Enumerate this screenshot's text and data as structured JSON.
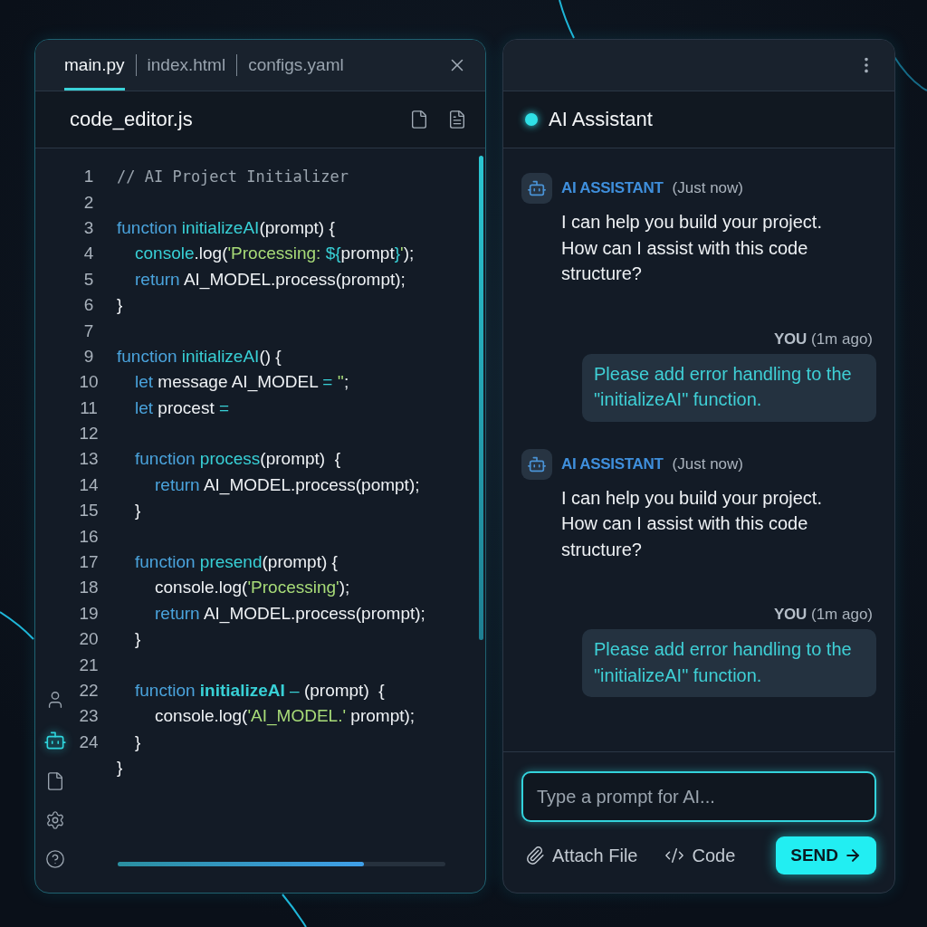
{
  "editor": {
    "tabs": [
      {
        "label": "main.py",
        "selected": true
      },
      {
        "label": "index.html",
        "selected": false
      },
      {
        "label": "configs.yaml",
        "selected": false
      }
    ],
    "file_title": "code_editor.js",
    "lines": [
      {
        "number": "1",
        "kind": "indent0",
        "tokens": [
          {
            "kind": "comment",
            "text": "// AI Project Initializer"
          }
        ]
      },
      {
        "number": "2"
      },
      {
        "number": "3",
        "kind": "indent0",
        "tokens": [
          {
            "kind": "keyword",
            "text": "function "
          },
          {
            "kind": "name",
            "text": "initializeAI"
          },
          {
            "kind": "plain",
            "text": "(prompt) {"
          }
        ]
      },
      {
        "number": "4",
        "kind": "indent1",
        "tokens": [
          {
            "kind": "name",
            "text": "console"
          },
          {
            "kind": "plain",
            "text": ".log("
          },
          {
            "kind": "string",
            "text": "'Processing: "
          },
          {
            "kind": "name",
            "text": "${"
          },
          {
            "kind": "plain",
            "text": "prompt"
          },
          {
            "kind": "name",
            "text": "}"
          },
          {
            "kind": "string",
            "text": "'"
          },
          {
            "kind": "plain",
            "text": ");"
          }
        ]
      },
      {
        "number": "5",
        "kind": "indent1",
        "tokens": [
          {
            "kind": "keyword",
            "text": "return "
          },
          {
            "kind": "plain",
            "text": "AI_MODEL.process(prompt);"
          }
        ]
      },
      {
        "number": "6",
        "kind": "indent0",
        "tokens": [
          {
            "kind": "plain",
            "text": "}"
          }
        ]
      },
      {
        "number": "7"
      },
      {
        "number": "9",
        "kind": "indent0",
        "tokens": [
          {
            "kind": "keyword",
            "text": "function "
          },
          {
            "kind": "name",
            "text": "initializeAI"
          },
          {
            "kind": "plain",
            "text": "() {"
          }
        ]
      },
      {
        "number": "10",
        "kind": "indent1",
        "tokens": [
          {
            "kind": "keyword",
            "text": "let "
          },
          {
            "kind": "plain",
            "text": "message AI_MODEL "
          },
          {
            "kind": "name",
            "text": "= "
          },
          {
            "kind": "string",
            "text": "''"
          },
          {
            "kind": "plain",
            "text": ";"
          }
        ]
      },
      {
        "number": "11",
        "kind": "indent1",
        "tokens": [
          {
            "kind": "keyword",
            "text": "let "
          },
          {
            "kind": "plain",
            "text": "procest "
          },
          {
            "kind": "name",
            "text": "="
          }
        ]
      },
      {
        "number": "12"
      },
      {
        "number": "13",
        "kind": "indent1",
        "tokens": [
          {
            "kind": "keyword",
            "text": "function "
          },
          {
            "kind": "name",
            "text": "process"
          },
          {
            "kind": "plain",
            "text": "(prompt)  {"
          }
        ]
      },
      {
        "number": "14",
        "kind": "indent2",
        "tokens": [
          {
            "kind": "keyword",
            "text": "return "
          },
          {
            "kind": "plain",
            "text": "AI_MODEL.process(pompt);"
          }
        ]
      },
      {
        "number": "15",
        "kind": "indent1",
        "tokens": [
          {
            "kind": "plain",
            "text": "}"
          }
        ]
      },
      {
        "number": "16"
      },
      {
        "number": "17",
        "kind": "indent1",
        "tokens": [
          {
            "kind": "keyword",
            "text": "function "
          },
          {
            "kind": "name",
            "text": "presend"
          },
          {
            "kind": "plain",
            "text": "(prompt) {"
          }
        ]
      },
      {
        "number": "18",
        "kind": "indent2",
        "tokens": [
          {
            "kind": "plain",
            "text": "console.log("
          },
          {
            "kind": "string",
            "text": "'Processing'"
          },
          {
            "kind": "plain",
            "text": ");"
          }
        ]
      },
      {
        "number": "19",
        "kind": "indent2",
        "tokens": [
          {
            "kind": "keyword",
            "text": "return "
          },
          {
            "kind": "plain",
            "text": "AI_MODEL.process(prompt);"
          }
        ]
      },
      {
        "number": "20",
        "kind": "indent1",
        "tokens": [
          {
            "kind": "plain",
            "text": "}"
          }
        ]
      },
      {
        "number": "21"
      },
      {
        "number": "22",
        "kind": "indent1",
        "tokens": [
          {
            "kind": "keyword",
            "text": "function "
          },
          {
            "kind": "boldname",
            "text": "initializeAI"
          },
          {
            "kind": "name",
            "text": " – "
          },
          {
            "kind": "plain",
            "text": "(prompt)  {"
          }
        ]
      },
      {
        "number": "23",
        "kind": "indent2",
        "tokens": [
          {
            "kind": "plain",
            "text": "console.log("
          },
          {
            "kind": "string",
            "text": "'AI_MODEL.'"
          },
          {
            "kind": "plain",
            "text": " prompt);"
          }
        ]
      },
      {
        "number": "24",
        "kind": "indent1",
        "tokens": [
          {
            "kind": "plain",
            "text": "}"
          }
        ]
      },
      {
        "kind": "indent0",
        "tokens": [
          {
            "kind": "plain",
            "text": "}"
          }
        ]
      }
    ],
    "sidebar": [
      {
        "kind": "user",
        "selected": false
      },
      {
        "kind": "bot",
        "selected": true
      },
      {
        "kind": "file",
        "selected": false
      },
      {
        "kind": "settings",
        "selected": false
      },
      {
        "kind": "help",
        "selected": false
      }
    ]
  },
  "assistant": {
    "title": "AI Assistant",
    "messages": [
      {
        "kind": "ai",
        "author": "AI ASSISTANT",
        "time": "(Just now)",
        "text": "I can help you build your project. How can I assist with this code structure?"
      },
      {
        "kind": "user",
        "author": "YOU",
        "time": "(1m ago)",
        "text": "Please add error handling to the \"initializeAI\" function."
      },
      {
        "kind": "ai",
        "author": "AI ASSISTANT",
        "time": "(Just now)",
        "text": "I can help you build your project. How can I assist with this code structure?"
      },
      {
        "kind": "user",
        "author": "YOU",
        "time": "(1m ago)",
        "text": "Please add error handling to the \"initializeAI\" function."
      }
    ],
    "input": {
      "placeholder": "Type a prompt for AI..."
    },
    "actions": [
      {
        "kind": "attach",
        "label": "Attach File"
      },
      {
        "kind": "code",
        "label": "Code"
      }
    ],
    "send": "SEND"
  }
}
